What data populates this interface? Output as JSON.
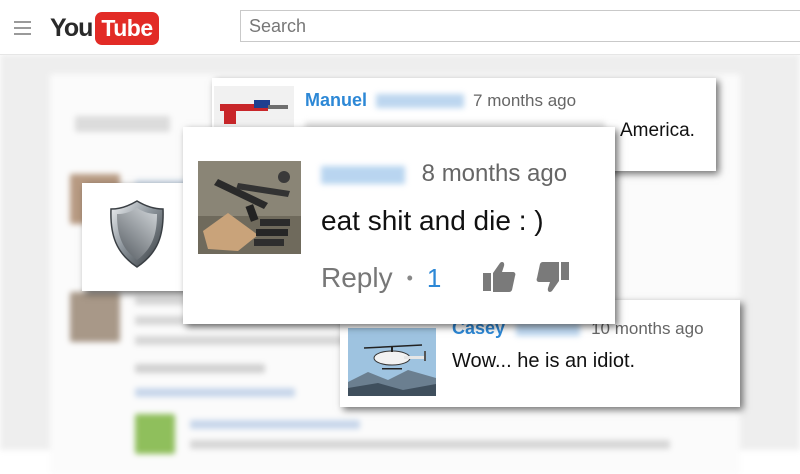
{
  "header": {
    "logo_you": "You",
    "logo_tube": "Tube",
    "search_placeholder": "Search"
  },
  "comments": {
    "manuel": {
      "name": "Manuel",
      "time": "7 months ago",
      "text": "America."
    },
    "main": {
      "time": "8 months ago",
      "text": "eat shit and die : )",
      "reply_label": "Reply",
      "separator": "•",
      "like_count": "1"
    },
    "casey": {
      "name": "Casey",
      "time": "10 months ago",
      "text": "Wow... he is an idiot."
    }
  },
  "colors": {
    "brand_red": "#e22b26",
    "link_blue": "#2d88d6",
    "meta_gray": "#666666"
  },
  "icons": [
    "menu-icon",
    "shield-icon",
    "thumbs-up-icon",
    "thumbs-down-icon"
  ]
}
